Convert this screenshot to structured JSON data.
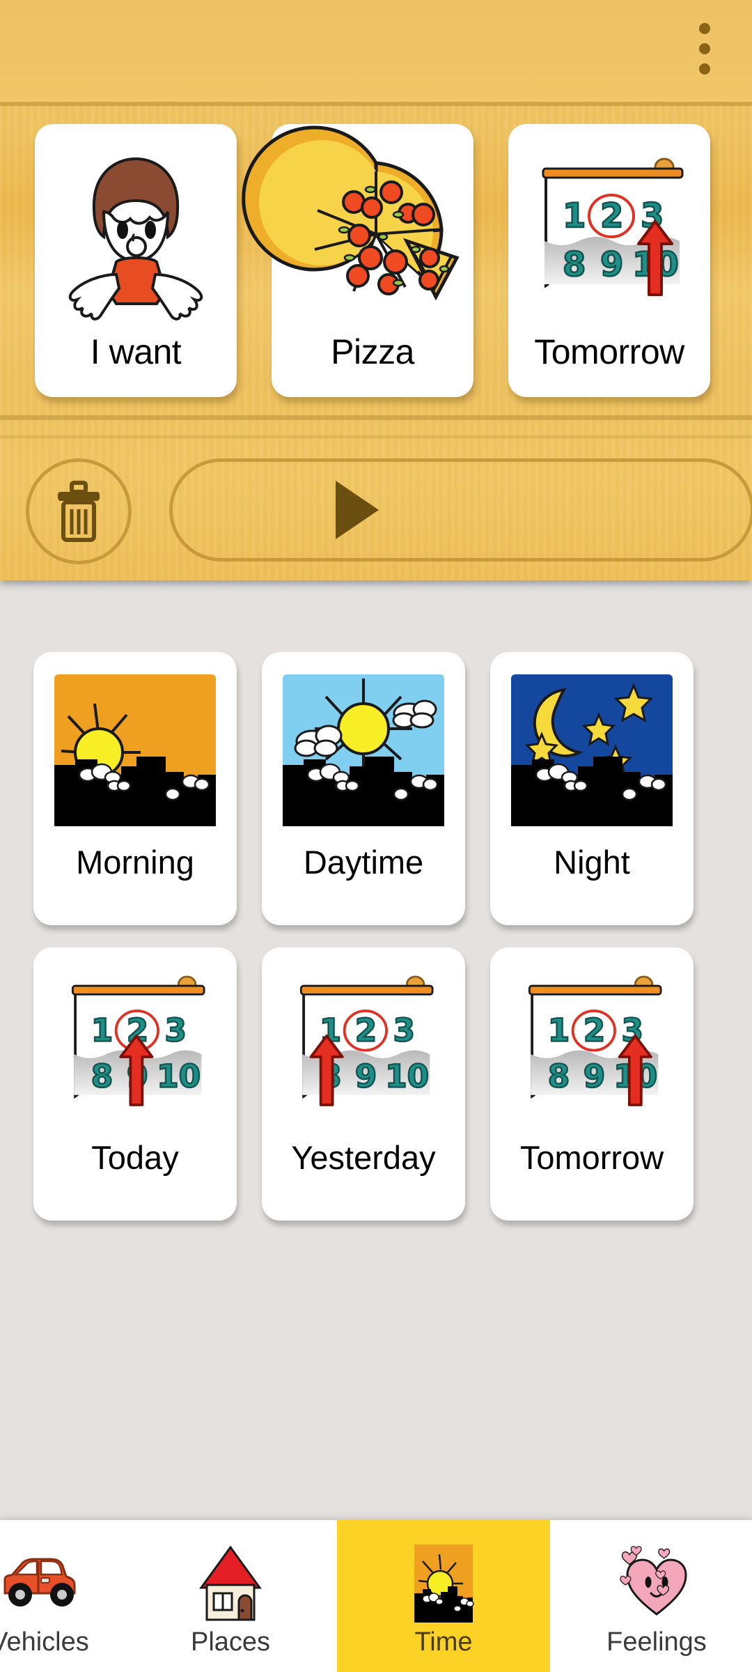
{
  "header": {
    "menu_icon": "overflow-menu-icon",
    "accent_wood": "#efc260",
    "menu_dot_color": "#8a6414"
  },
  "sentence_bar": {
    "cards": [
      {
        "label": "I want",
        "icon": "person-wanting-icon"
      },
      {
        "label": "Pizza",
        "icon": "pizza-icon"
      },
      {
        "label": "Tomorrow",
        "icon": "calendar-tomorrow-icon"
      }
    ],
    "toolbar": {
      "delete_label": "Delete",
      "delete_icon": "trash-icon",
      "speak_label": "Speak",
      "speak_icon": "play-icon"
    }
  },
  "main": {
    "category": "Time",
    "background": "#e4e1de",
    "tiles": [
      {
        "label": "Morning",
        "icon": "sunrise-city-icon"
      },
      {
        "label": "Daytime",
        "icon": "sun-clouds-city-icon"
      },
      {
        "label": "Night",
        "icon": "moon-stars-city-icon"
      },
      {
        "label": "Today",
        "icon": "calendar-today-icon"
      },
      {
        "label": "Yesterday",
        "icon": "calendar-yesterday-icon"
      },
      {
        "label": "Tomorrow",
        "icon": "calendar-tomorrow-icon"
      }
    ]
  },
  "bottom_nav": {
    "selected": "Time",
    "selected_color": "#fcd226",
    "items": [
      {
        "label": "Vehicles",
        "icon": "car-icon",
        "selected": false
      },
      {
        "label": "Places",
        "icon": "house-icon",
        "selected": false
      },
      {
        "label": "Time",
        "icon": "sunrise-icon",
        "selected": true
      },
      {
        "label": "Feelings",
        "icon": "heart-face-icon",
        "selected": false
      }
    ]
  }
}
